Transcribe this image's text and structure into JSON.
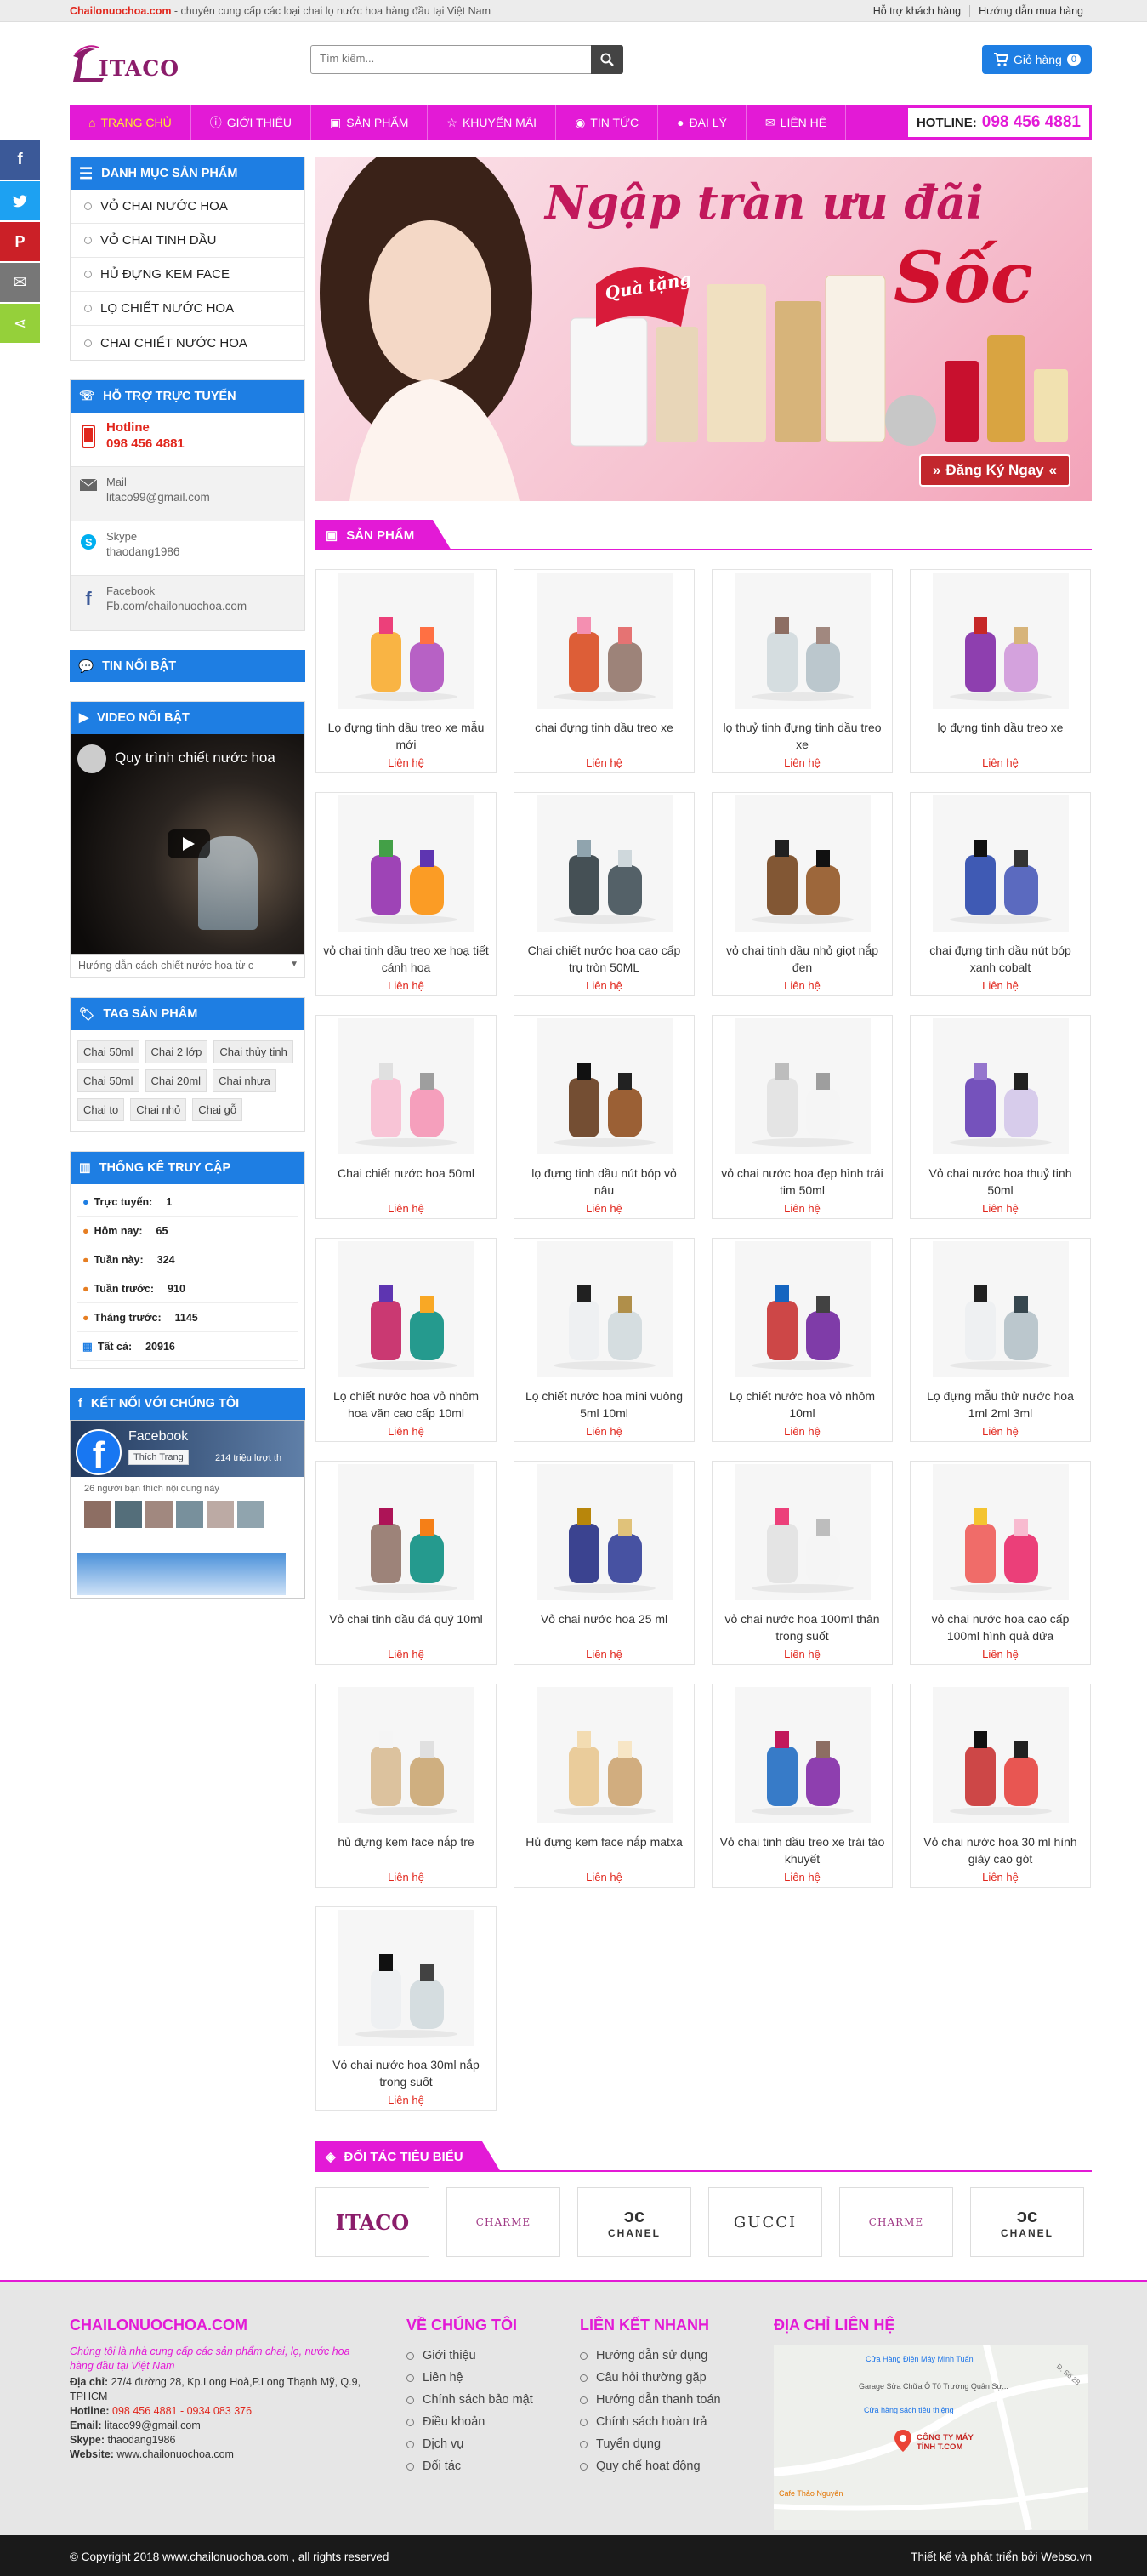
{
  "topbar": {
    "brand": "Chailonuochoa.com",
    "tagline": " - chuyên cung cấp các loại chai lọ nước hoa hàng đầu tại Việt Nam",
    "links": [
      "Hỗ trợ khách hàng",
      "Hướng dẫn mua hàng"
    ]
  },
  "header": {
    "logo_text": "ITACO",
    "search_placeholder": "Tìm kiếm...",
    "cart_label": "Giỏ hàng",
    "cart_count": "0"
  },
  "nav": {
    "items": [
      "TRANG CHỦ",
      "GIỚI THIỆU",
      "SẢN PHẨM",
      "KHUYẾN MÃI",
      "TIN TỨC",
      "ĐẠI LÝ",
      "LIÊN HỆ"
    ],
    "hotline_label": "HOTLINE:",
    "hotline": "098 456 4881"
  },
  "sidebar": {
    "categories_title": "DANH MỤC SẢN PHẨM",
    "categories": [
      "VỎ CHAI NƯỚC HOA",
      "VỎ CHAI TINH DẦU",
      "HỦ ĐỰNG KEM FACE",
      "LỌ CHIẾT NƯỚC HOA",
      "CHAI CHIẾT NƯỚC HOA"
    ],
    "support_title": "HỖ TRỢ TRỰC TUYẾN",
    "support": [
      {
        "l1": "Hotline",
        "l2": "098 456 4881"
      },
      {
        "l1": "Mail",
        "l2": "litaco99@gmail.com"
      },
      {
        "l1": "Skype",
        "l2": "thaodang1986"
      },
      {
        "l1": "Facebook",
        "l2": "Fb.com/chailonuochoa.com"
      }
    ],
    "news_title": "TIN NỔI BẬT",
    "video_title": "VIDEO NỔI BẬT",
    "video_caption": "Quy trình chiết nước hoa",
    "video_select": "Hướng dẫn cách chiết nước hoa từ c",
    "tags_title": "TAG SẢN PHẨM",
    "tags": [
      "Chai 50ml",
      "Chai 2 lớp",
      "Chai thủy tinh",
      "Chai 50ml",
      "Chai 20ml",
      "Chai nhựa",
      "Chai to",
      "Chai nhỏ",
      "Chai gỗ"
    ],
    "stats_title": "THỐNG KÊ TRUY CẬP",
    "stats": [
      {
        "label": "Trực tuyến:",
        "value": "1"
      },
      {
        "label": "Hôm nay:",
        "value": "65"
      },
      {
        "label": "Tuần này:",
        "value": "324"
      },
      {
        "label": "Tuần trước:",
        "value": "910"
      },
      {
        "label": "Tháng trước:",
        "value": "1145"
      },
      {
        "label": "Tất cả:",
        "value": "20916"
      }
    ],
    "fb_title": "KẾT NỐI VỚI CHÚNG TÔI",
    "fb_name": "Facebook",
    "fb_like": "Thích Trang",
    "fb_count": "214 triệu lượt th",
    "fb_friends": "26 người bạn thích nội dung này"
  },
  "banner": {
    "headline": "Ngập tràn ưu đãi",
    "big": "Sốc",
    "ribbon": "Quà tặng",
    "cta": "Đăng Ký Ngay"
  },
  "products_title": "SẢN PHẨM",
  "products": [
    {
      "name": "Lọ đựng tinh dầu treo xe mẫu mới",
      "price": "Liên hệ",
      "kind": "hang-multi"
    },
    {
      "name": "chai đựng tinh dầu treo xe",
      "price": "Liên hệ",
      "kind": "hang-red"
    },
    {
      "name": "lọ thuỷ tinh đựng tinh dầu treo xe",
      "price": "Liên hệ",
      "kind": "hang-clear"
    },
    {
      "name": "lọ đựng tinh dầu treo xe",
      "price": "Liên hệ",
      "kind": "hang-purple"
    },
    {
      "name": "vỏ chai tinh dầu treo xe hoạ tiết cánh hoa",
      "price": "Liên hệ",
      "kind": "flower"
    },
    {
      "name": "Chai chiết nước hoa cao cấp trụ tròn 50ML",
      "price": "Liên hệ",
      "kind": "black-cyl"
    },
    {
      "name": "vỏ chai tinh dầu nhỏ giọt nắp đen",
      "price": "Liên hệ",
      "kind": "amber"
    },
    {
      "name": "chai đựng tinh dầu nút bóp xanh cobalt",
      "price": "Liên hệ",
      "kind": "cobalt"
    },
    {
      "name": "Chai chiết nước hoa 50ml",
      "price": "Liên hệ",
      "kind": "pink-sq"
    },
    {
      "name": "lọ đựng tinh dầu nút bóp vỏ nâu",
      "price": "Liên hệ",
      "kind": "amber2"
    },
    {
      "name": "vỏ chai nước hoa đẹp hình trái tim 50ml",
      "price": "Liên hệ",
      "kind": "heart"
    },
    {
      "name": "Vỏ chai nước hoa thuỷ tinh 50ml",
      "price": "Liên hệ",
      "kind": "violet"
    },
    {
      "name": "Lọ chiết nước hoa vỏ nhôm hoa văn cao cấp 10ml",
      "price": "Liên hệ",
      "kind": "alu-multi"
    },
    {
      "name": "Lọ chiết nước hoa mini vuông 5ml 10ml",
      "price": "Liên hệ",
      "kind": "mini-sq"
    },
    {
      "name": "Lọ chiết nước hoa vỏ nhôm 10ml",
      "price": "Liên hệ",
      "kind": "alu"
    },
    {
      "name": "Lọ đựng mẫu thử nước hoa 1ml 2ml 3ml",
      "price": "Liên hệ",
      "kind": "vials"
    },
    {
      "name": "Vỏ chai tinh dầu đá quý 10ml",
      "price": "Liên hệ",
      "kind": "gems"
    },
    {
      "name": "Vỏ chai nước hoa 25 ml",
      "price": "Liên hệ",
      "kind": "navy"
    },
    {
      "name": "vỏ chai nước hoa 100ml thân trong suốt",
      "price": "Liên hệ",
      "kind": "bow"
    },
    {
      "name": "vỏ chai nước hoa cao cấp 100ml hình quả dứa",
      "price": "Liên hệ",
      "kind": "pineapple"
    },
    {
      "name": "hủ đựng kem face nắp tre",
      "price": "Liên hệ",
      "kind": "bamboo"
    },
    {
      "name": "Hủ đựng kem face nắp matxa",
      "price": "Liên hệ",
      "kind": "gold-jar"
    },
    {
      "name": "Vỏ chai tinh dầu treo xe trái táo khuyết",
      "price": "Liên hệ",
      "kind": "apple"
    },
    {
      "name": "Vỏ chai nước hoa 30 ml hình giày cao gót",
      "price": "Liên hệ",
      "kind": "shoe"
    },
    {
      "name": "Vỏ chai nước hoa 30ml nắp trong suốt",
      "price": "Liên hệ",
      "kind": "square-clear"
    }
  ],
  "partners_title": "ĐỐI TÁC TIÊU BIỂU",
  "partners": [
    "ITACO",
    "CHARME",
    "CHANEL",
    "GUCCI",
    "CHARME",
    "CHANEL"
  ],
  "footer": {
    "about_title": "CHAILONUOCHOA.COM",
    "about_desc": "Chúng tôi là nhà cung cấp các sản phẩm chai, lọ, nước hoa hàng đầu tại Việt Nam",
    "address_label": "Địa chỉ:",
    "address": "27/4 đường 28, Kp.Long Hoà,P.Long Thạnh Mỹ, Q.9, TPHCM",
    "hotline_label": "Hotline:",
    "hotline": "098 456 4881 - 0934 083 376",
    "email_label": "Email:",
    "email": "litaco99@gmail.com",
    "skype_label": "Skype:",
    "skype": "thaodang1986",
    "website_label": "Website:",
    "website": "www.chailonuochoa.com",
    "col2_title": "VỀ CHÚNG TÔI",
    "col2": [
      "Giới thiệu",
      "Liên hệ",
      "Chính sách bảo mật",
      "Điều khoản",
      "Dịch vụ",
      "Đối tác"
    ],
    "col3_title": "LIÊN KẾT NHANH",
    "col3": [
      "Hướng dẫn sử dụng",
      "Câu hỏi thường gặp",
      "Hướng dẫn thanh toán",
      "Chính sách hoàn trả",
      "Tuyển dụng",
      "Quy chế hoạt động"
    ],
    "col4_title": "ĐỊA CHỈ LIÊN HỆ",
    "map_labels": [
      "Cửa Hàng Điện Máy Minh Tuấn",
      "Garage Sửa Chữa Ô Tô Trường Quân Sự...",
      "Cửa hàng sách tiêu thiệng",
      "CÔNG TY MÁY TÍNH T.COM",
      "Cafe Thảo Nguyên",
      "Đ. Số 28"
    ],
    "copyright": "© Copyright 2018 www.chailonuochoa.com , all rights reserved",
    "credit": "Thiết kế và phát triển bởi Webso.vn"
  }
}
